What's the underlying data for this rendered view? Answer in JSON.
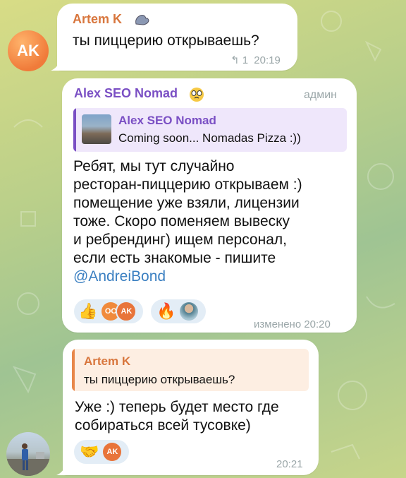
{
  "messages": [
    {
      "author": "Artem K",
      "avatar_initials": "AK",
      "text": "ты пиццерию открываешь?",
      "replies_count": "1",
      "time": "20:19",
      "author_color": "#d8763d"
    },
    {
      "author": "Alex SEO Nomad",
      "role": "админ",
      "quote": {
        "author": "Alex SEO Nomad",
        "text": "Coming soon... Nomadas Pizza :))"
      },
      "lines": [
        "Ребят, мы тут случайно",
        "ресторан-пиццерию открываем :)",
        "помещение уже взяли, лицензии",
        "тоже. Скоро поменяем вывеску",
        "и ребрендинг) ищем персонал,",
        "если есть знакомые - пишите"
      ],
      "mention": "@AndreiBond",
      "reactions": [
        {
          "emoji": "👍",
          "avatars": [
            "ОО",
            "AK"
          ]
        },
        {
          "emoji": "🔥",
          "avatars": [
            ""
          ]
        }
      ],
      "edited_time": "изменено 20:20",
      "author_color": "#7a4fc4"
    },
    {
      "quote": {
        "author": "Artem K",
        "text": "ты пиццерию открываешь?"
      },
      "lines": [
        "Уже :) теперь будет место где",
        "собираться всей тусовке)"
      ],
      "reactions": [
        {
          "emoji": "🤝",
          "avatars": [
            "AK"
          ]
        }
      ],
      "time": "20:21"
    }
  ],
  "colors": {
    "accent_orange": "#d8763d",
    "accent_purple": "#7a4fc4",
    "link": "#3a7fc1",
    "reaction_bg": "#e3edf6"
  }
}
